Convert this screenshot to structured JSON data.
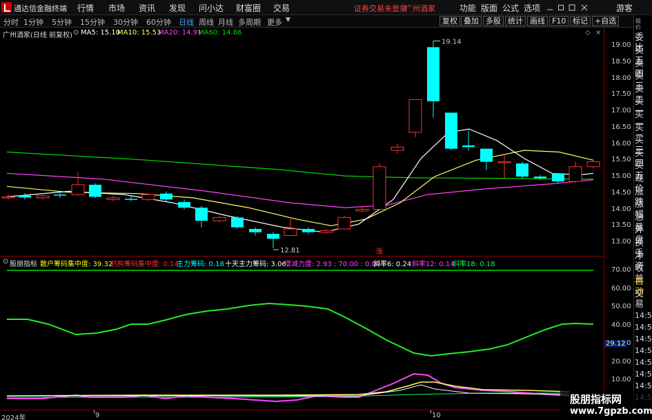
{
  "app": {
    "name": "通达信金融终端"
  },
  "menu": [
    "行情",
    "市场",
    "资讯",
    "发现",
    "问小达",
    "财富圈",
    "交易"
  ],
  "login_status": "证券交易未登录",
  "stock_title": "广州酒家",
  "right_menu": [
    "功能",
    "版面",
    "公式",
    "选项",
    "游客"
  ],
  "periods": [
    "分时",
    "1分钟",
    "5分钟",
    "15分钟",
    "30分钟",
    "60分钟",
    "日线",
    "周线",
    "月线",
    "多周期",
    "更多"
  ],
  "active_period": "日线",
  "tool_buttons": [
    "复权",
    "叠加",
    "多股",
    "统计",
    "画线",
    "F10",
    "标记",
    "+自选"
  ],
  "main_header": {
    "title": "广州酒家(日线 前复权)",
    "ma5": "MA5: 15.10",
    "ma10": "MA10: 15.53",
    "ma20": "MA20: 14.91",
    "ma60": "MA60: 14.86"
  },
  "colors": {
    "up": "#ff3333",
    "down": "#00ffff",
    "ma5": "#ffffff",
    "ma10": "#ffff66",
    "ma20": "#ff44ff",
    "ma60": "#00dd00"
  },
  "price_axis": [
    "19.00",
    "18.50",
    "18.00",
    "17.50",
    "17.00",
    "16.50",
    "16.00",
    "15.50",
    "15.00",
    "14.50",
    "14.00",
    "13.50",
    "13.00"
  ],
  "price_annotations": {
    "high": "19.14",
    "low": "12.81",
    "limit_up": "涨"
  },
  "indicator": {
    "title": "股朋指标",
    "items": [
      {
        "label": "散户筹码集中度: 39.32",
        "color": "#ffff00"
      },
      {
        "label": "机构筹码集中度: 0.14",
        "color": "#ff3333"
      },
      {
        "label": "主力筹码: 0.18",
        "color": "#00ffff"
      },
      {
        "label": "十天主力筹码: 3.06",
        "color": "#ffffff"
      },
      {
        "label": "增减力度: 2.93 : 70.00 : 0.00",
        "color": "#ff44ff"
      },
      {
        "label": "斜率6: 0.24",
        "color": "#ffffff"
      },
      {
        "label": "斜率12: 0.14",
        "color": "#ff44ff"
      },
      {
        "label": "斜率18: 0.18",
        "color": "#00ff66"
      }
    ],
    "axis": [
      "70.00",
      "60.00",
      "50.00",
      "40.00",
      "30.00",
      "20.00",
      "10.00"
    ],
    "current_value": "29.12"
  },
  "x_axis": {
    "labels": [
      "2024年",
      "9",
      "10"
    ]
  },
  "right_panel": {
    "top": "委比",
    "items": [
      "卖五",
      "卖四",
      "卖三",
      "卖二",
      "卖一",
      "买一",
      "买二",
      "买三",
      "买四",
      "买五",
      "现价",
      "涨跌",
      "涨幅",
      "总量",
      "外盘",
      "换手",
      "净资",
      "收益",
      "自动",
      "交易"
    ],
    "times": [
      "14:5",
      "14:5",
      "14:5",
      "14:5",
      "14:5",
      "14:5",
      "14:5",
      "14:5"
    ]
  },
  "watermark": {
    "line1": "股朋指标网",
    "line2": "www.7gpzb.com"
  }
}
